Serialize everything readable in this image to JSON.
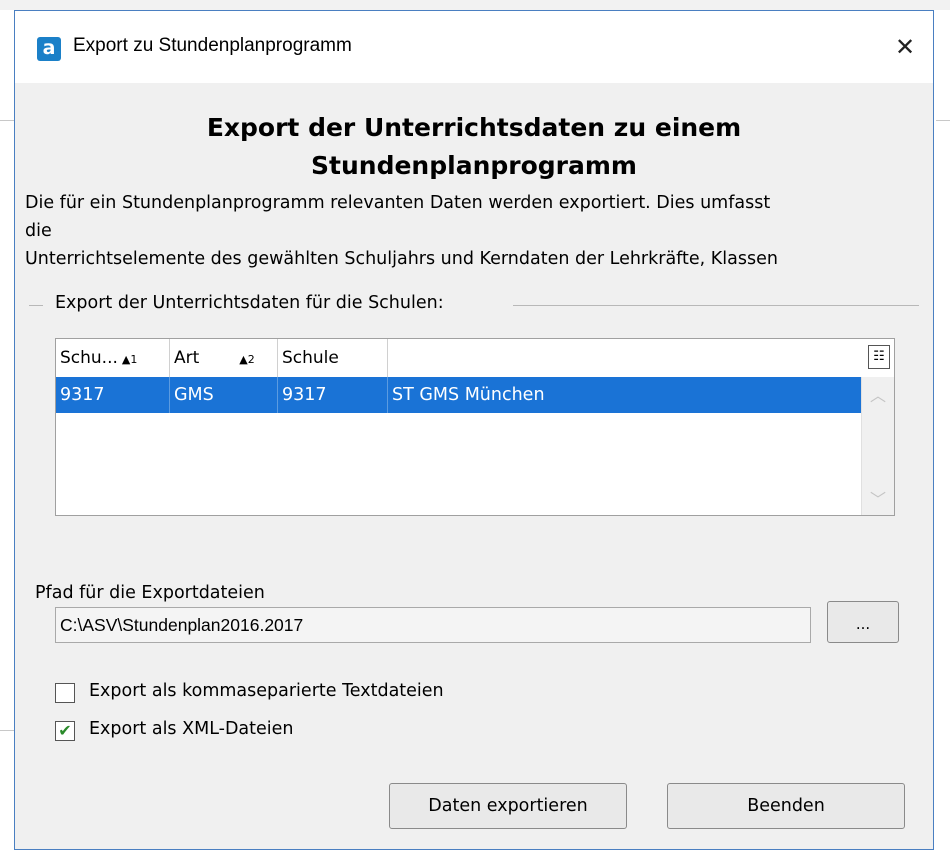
{
  "window": {
    "title": "Export zu Stundenplanprogramm",
    "close": "✕",
    "app_icon": "a"
  },
  "heading": {
    "line1": "Export der Unterrichtsdaten zu einem",
    "line2": "Stundenplanprogramm"
  },
  "description": {
    "line1": "Die für ein Stundenplanprogramm relevanten Daten werden exportiert. Dies umfasst",
    "line2": "die",
    "line3": "Unterrichtselemente des gewählten Schuljahrs und Kerndaten der Lehrkräfte, Klassen"
  },
  "group": {
    "label": "Export der Unterrichtsdaten für die Schulen:"
  },
  "table": {
    "columns": [
      {
        "label": "Schu...",
        "sort": "▲1"
      },
      {
        "label": "Art",
        "sort": "▲2"
      },
      {
        "label": "Schule",
        "sort": ""
      },
      {
        "label": "",
        "sort": ""
      }
    ],
    "rows": [
      {
        "cells": [
          "9317",
          "GMS",
          "9317",
          "ST GMS München"
        ],
        "selected": true
      }
    ]
  },
  "path": {
    "label": "Pfad für die Exportdateien",
    "value": "C:\\ASV\\Stundenplan2016.2017",
    "browse_label": "..."
  },
  "options": [
    {
      "label": "Export als kommaseparierte Textdateien",
      "checked": false
    },
    {
      "label": "Export als XML-Dateien",
      "checked": true
    }
  ],
  "buttons": {
    "export": "Daten exportieren",
    "close": "Beenden"
  },
  "colors": {
    "selection": "#1a73d6",
    "dialog_bg": "#f0f0f0",
    "app_icon": "#1b80c8",
    "check": "#2a8a2a"
  }
}
